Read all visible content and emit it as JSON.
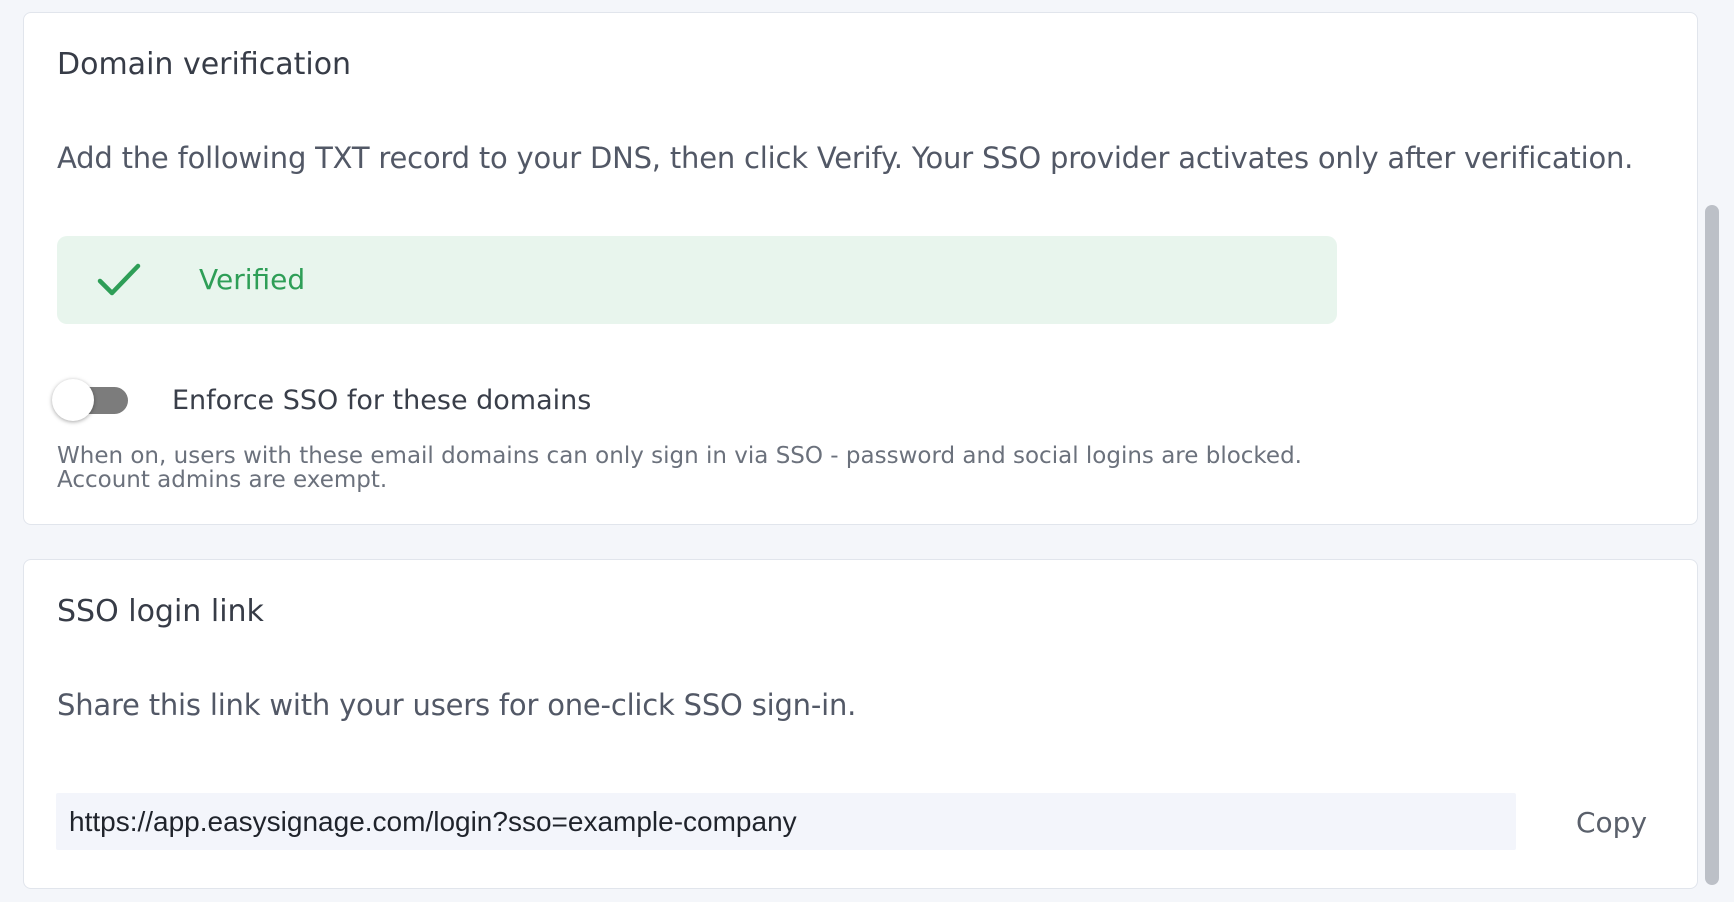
{
  "domain_verification": {
    "title": "Domain verification",
    "description": "Add the following TXT record to your DNS, then click Verify. Your SSO provider activates only after verification.",
    "status": {
      "label": "Verified",
      "icon": "checkmark-icon",
      "color": "#2e9e57",
      "background": "#e8f5ed"
    },
    "enforce_toggle": {
      "label": "Enforce SSO for these domains",
      "state": "off"
    },
    "helper_lines": [
      "When on, users with these email domains can only sign in via SSO - password and social logins are blocked.",
      "Account admins are exempt."
    ]
  },
  "sso_login_link": {
    "title": "SSO login link",
    "description": "Share this link with your users for one-click SSO sign-in.",
    "url": "https://app.easysignage.com/login?sso=example-company",
    "copy_label": "Copy"
  }
}
